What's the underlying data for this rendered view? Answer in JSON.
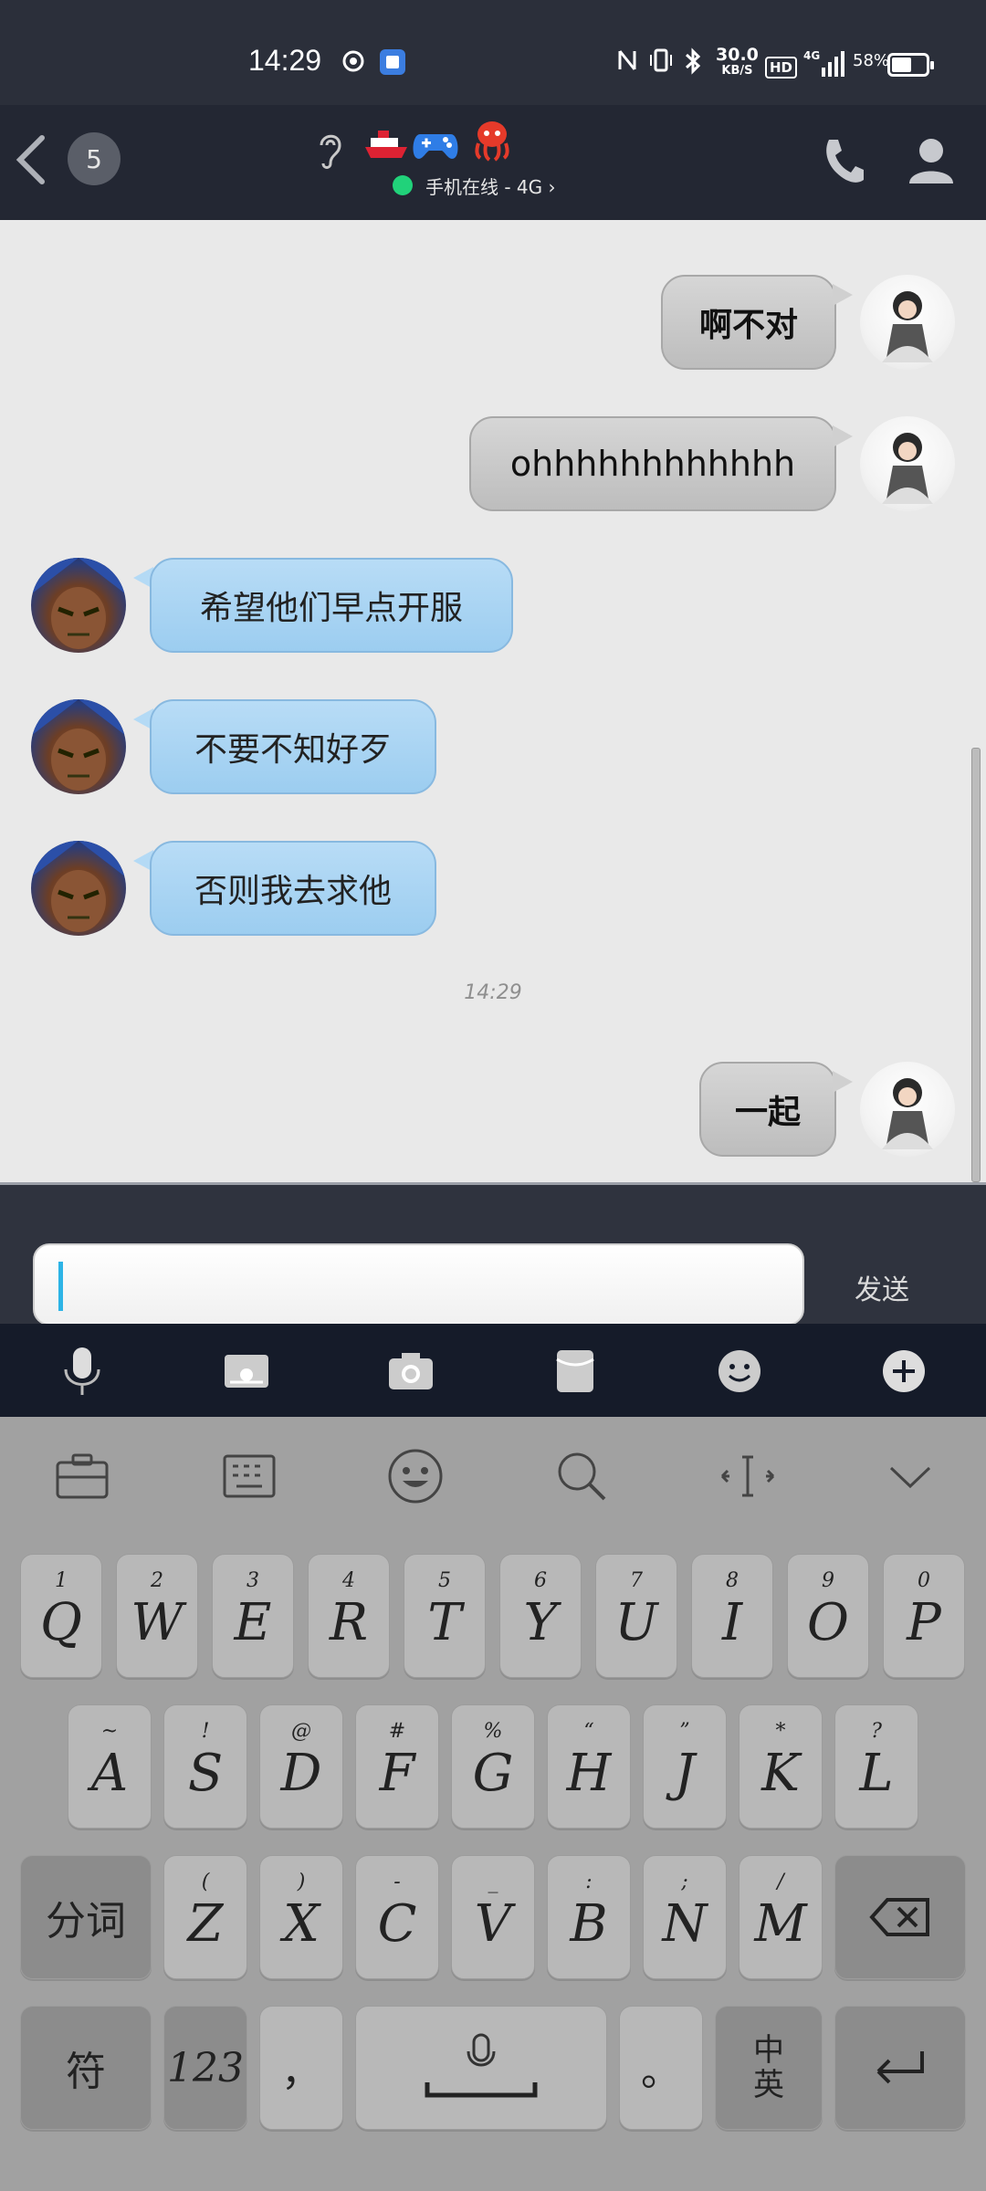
{
  "status_bar": {
    "time": "14:29",
    "network_speed_value": "30.0",
    "network_speed_unit": "KB/S",
    "signal_label": "4G",
    "battery_pct": "58",
    "battery_level": 0.58,
    "hd_label": "HD"
  },
  "header": {
    "unread_count": "5",
    "online_status": "手机在线 - 4G",
    "back_icon": "chevron-left-icon",
    "call_icon": "phone-icon",
    "profile_icon": "person-icon"
  },
  "messages": [
    {
      "direction": "out",
      "text": "啊不对"
    },
    {
      "direction": "out",
      "text": "ohhhhhhhhhhhh"
    },
    {
      "direction": "in",
      "text": "希望他们早点开服"
    },
    {
      "direction": "in",
      "text": "不要不知好歹"
    },
    {
      "direction": "in",
      "text": "否则我去求他"
    },
    {
      "direction": "out",
      "text": "一起"
    }
  ],
  "timestamp": "14:29",
  "input": {
    "value": "",
    "send_label": "发送"
  },
  "toolbar": {
    "icons": [
      "microphone-icon",
      "image-icon",
      "camera-icon",
      "red-packet-icon",
      "emoji-icon",
      "plus-icon"
    ]
  },
  "keyboard": {
    "top_icons": [
      "toolbox-icon",
      "keyboard-icon",
      "emoji-icon",
      "search-icon",
      "cursor-move-icon",
      "collapse-icon"
    ],
    "row1": [
      {
        "k": "Q",
        "s": "1"
      },
      {
        "k": "W",
        "s": "2"
      },
      {
        "k": "E",
        "s": "3"
      },
      {
        "k": "R",
        "s": "4"
      },
      {
        "k": "T",
        "s": "5"
      },
      {
        "k": "Y",
        "s": "6"
      },
      {
        "k": "U",
        "s": "7"
      },
      {
        "k": "I",
        "s": "8"
      },
      {
        "k": "O",
        "s": "9"
      },
      {
        "k": "P",
        "s": "0"
      }
    ],
    "row2": [
      {
        "k": "A",
        "s": "~"
      },
      {
        "k": "S",
        "s": "!"
      },
      {
        "k": "D",
        "s": "@"
      },
      {
        "k": "F",
        "s": "#"
      },
      {
        "k": "G",
        "s": "%"
      },
      {
        "k": "H",
        "s": "“"
      },
      {
        "k": "J",
        "s": "”"
      },
      {
        "k": "K",
        "s": "*"
      },
      {
        "k": "L",
        "s": "?"
      }
    ],
    "row3": [
      {
        "k": "Z",
        "s": "("
      },
      {
        "k": "X",
        "s": ")"
      },
      {
        "k": "C",
        "s": "-"
      },
      {
        "k": "V",
        "s": "_"
      },
      {
        "k": "B",
        "s": ":"
      },
      {
        "k": "N",
        "s": ";"
      },
      {
        "k": "M",
        "s": "/"
      }
    ],
    "segment_label": "分词",
    "symbol_label": "符",
    "number_label": "123",
    "comma_label": "，",
    "period_label": "。",
    "lang_top": "中",
    "lang_bottom": "英",
    "backspace_icon": "backspace-icon",
    "enter_icon": "enter-icon",
    "space_icon": "microphone-space-icon"
  }
}
